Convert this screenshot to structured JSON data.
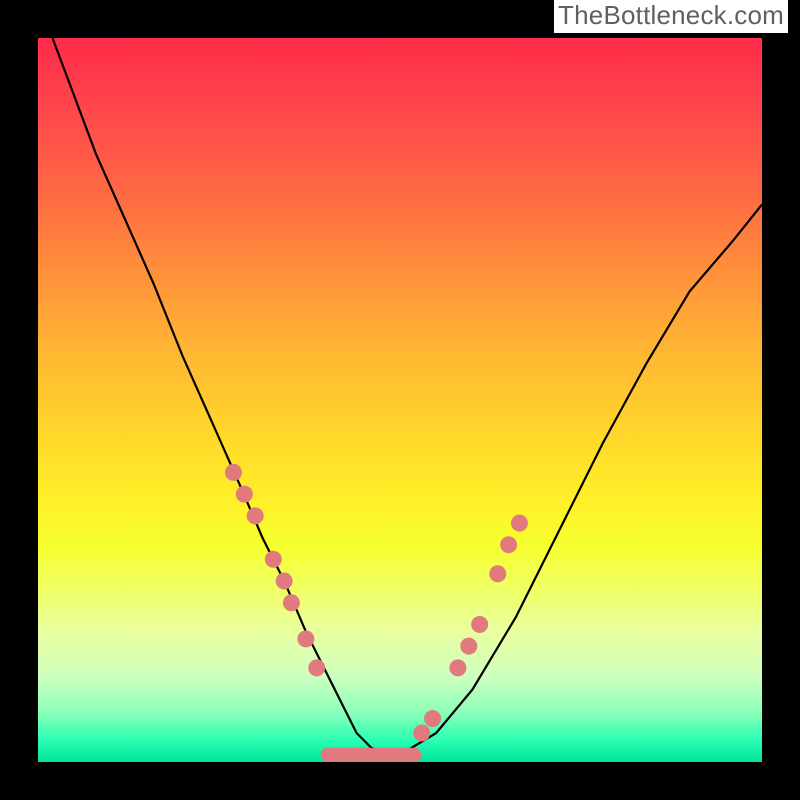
{
  "attribution": "TheBottleneck.com",
  "chart_data": {
    "type": "line",
    "title": "",
    "xlabel": "",
    "ylabel": "",
    "xlim": [
      0,
      100
    ],
    "ylim": [
      0,
      100
    ],
    "curve": {
      "name": "bottleneck-curve",
      "x": [
        2,
        5,
        8,
        12,
        16,
        20,
        24,
        28,
        31,
        34,
        37,
        40,
        42,
        44,
        46,
        48,
        50,
        55,
        60,
        66,
        72,
        78,
        84,
        90,
        96,
        100
      ],
      "y": [
        100,
        92,
        84,
        75,
        66,
        56,
        47,
        38,
        31,
        25,
        18,
        12,
        8,
        4,
        2,
        1,
        1,
        4,
        10,
        20,
        32,
        44,
        55,
        65,
        72,
        77
      ]
    },
    "markers_left": {
      "x": [
        27,
        28.5,
        30,
        32.5,
        34,
        35,
        37,
        38.5
      ],
      "y": [
        40,
        37,
        34,
        28,
        25,
        22,
        17,
        13
      ]
    },
    "markers_right": {
      "x": [
        53,
        54.5,
        58,
        59.5,
        61,
        63.5,
        65,
        66.5
      ],
      "y": [
        4,
        6,
        13,
        16,
        19,
        26,
        30,
        33
      ]
    },
    "baseline": {
      "x": [
        40,
        52
      ],
      "y": [
        1,
        1
      ]
    },
    "gradient_stops": [
      {
        "pos": 0,
        "color": "#ff2b4a"
      },
      {
        "pos": 22,
        "color": "#ff6b43"
      },
      {
        "pos": 42,
        "color": "#ffb233"
      },
      {
        "pos": 64,
        "color": "#fff028"
      },
      {
        "pos": 82,
        "color": "#e9ffa0"
      },
      {
        "pos": 100,
        "color": "#00e39b"
      }
    ]
  }
}
